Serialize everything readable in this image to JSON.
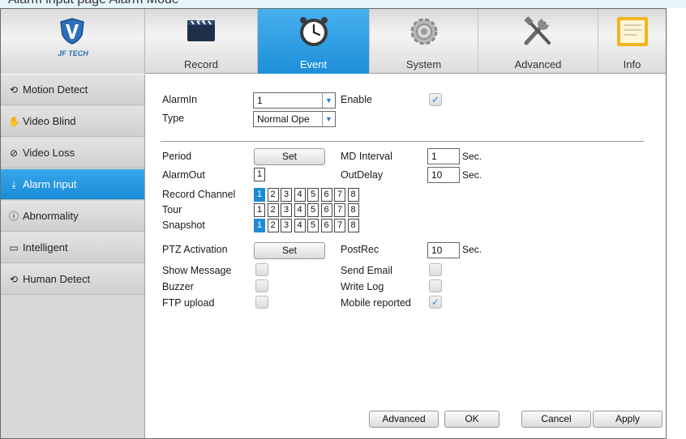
{
  "top_caption": "Alarm input page  Alarm Mode",
  "brand": {
    "logo_text": "JF TECH"
  },
  "nav": {
    "tabs": [
      {
        "label": "Record",
        "icon": "record-icon",
        "active": false
      },
      {
        "label": "Event",
        "icon": "clock-icon",
        "active": true
      },
      {
        "label": "System",
        "icon": "gear-icon",
        "active": false
      },
      {
        "label": "Advanced",
        "icon": "tools-icon",
        "active": false
      },
      {
        "label": "Info",
        "icon": "info-document-icon",
        "active": false
      }
    ]
  },
  "sidebar": {
    "items": [
      {
        "label": "Motion Detect",
        "icon": "motion-icon",
        "glyph": "⟲",
        "active": false
      },
      {
        "label": "Video Blind",
        "icon": "hand-icon",
        "glyph": "✋",
        "active": false
      },
      {
        "label": "Video Loss",
        "icon": "no-signal-icon",
        "glyph": "⊘",
        "active": false
      },
      {
        "label": "Alarm Input",
        "icon": "alarm-input-icon",
        "glyph": "⤓",
        "active": true
      },
      {
        "label": "Abnormality",
        "icon": "warning-circle-icon",
        "glyph": "ⓘ",
        "active": false
      },
      {
        "label": "Intelligent",
        "icon": "monitor-icon",
        "glyph": "▭",
        "active": false
      },
      {
        "label": "Human Detect",
        "icon": "human-icon",
        "glyph": "⟲",
        "active": false
      }
    ]
  },
  "form": {
    "alarmin": {
      "label": "AlarmIn",
      "value": "1"
    },
    "enable": {
      "label": "Enable",
      "checked": true
    },
    "type": {
      "label": "Type",
      "value": "Normal Ope"
    },
    "period": {
      "label": "Period",
      "button": "Set"
    },
    "md_interval": {
      "label": "MD Interval",
      "value": "1",
      "unit": "Sec."
    },
    "alarmout": {
      "label": "AlarmOut",
      "value": "1"
    },
    "outdelay": {
      "label": "OutDelay",
      "value": "10",
      "unit": "Sec."
    },
    "record_channel": {
      "label": "Record Channel",
      "channels": [
        "1",
        "2",
        "3",
        "4",
        "5",
        "6",
        "7",
        "8"
      ],
      "selected": [
        1
      ]
    },
    "tour": {
      "label": "Tour",
      "channels": [
        "1",
        "2",
        "3",
        "4",
        "5",
        "6",
        "7",
        "8"
      ],
      "selected": []
    },
    "snapshot": {
      "label": "Snapshot",
      "channels": [
        "1",
        "2",
        "3",
        "4",
        "5",
        "6",
        "7",
        "8"
      ],
      "selected": [
        1
      ]
    },
    "ptz_activation": {
      "label": "PTZ Activation",
      "button": "Set"
    },
    "postrec": {
      "label": "PostRec",
      "value": "10",
      "unit": "Sec."
    },
    "show_message": {
      "label": "Show Message",
      "checked": false
    },
    "send_email": {
      "label": "Send Email",
      "checked": false
    },
    "buzzer": {
      "label": "Buzzer",
      "checked": false
    },
    "write_log": {
      "label": "Write Log",
      "checked": false
    },
    "ftp_upload": {
      "label": "FTP upload",
      "checked": false
    },
    "mobile_reported": {
      "label": "Mobile reported",
      "checked": true
    }
  },
  "footer": {
    "advanced_label": "Advanced",
    "ok_label": "OK",
    "cancel_label": "Cancel",
    "apply_label": "Apply"
  },
  "colors": {
    "accent": "#1d8fd8",
    "sidebar_bg": "#d8d8d8",
    "header_bg": "#e8e8e8"
  }
}
